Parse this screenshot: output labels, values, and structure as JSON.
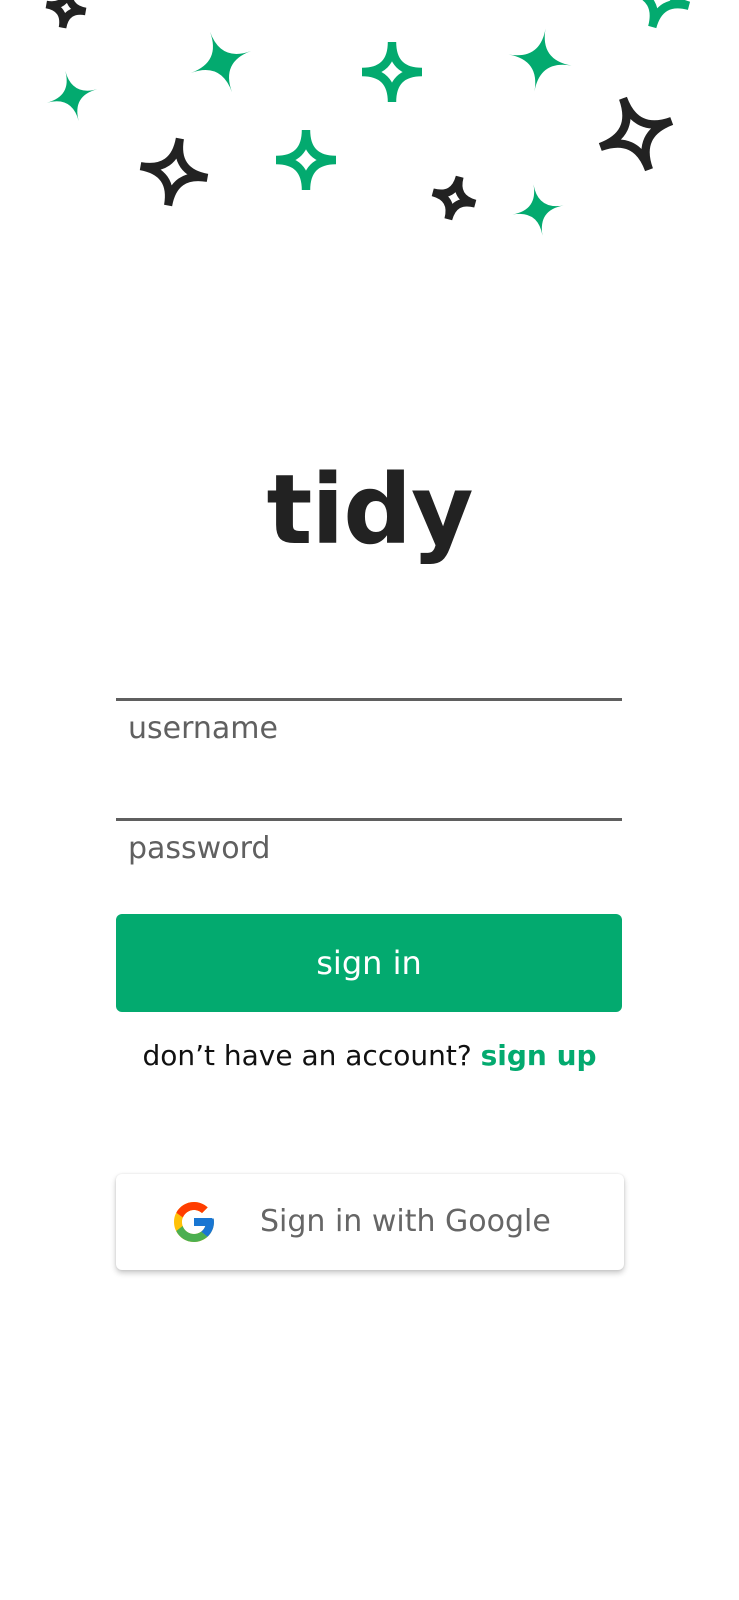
{
  "app": {
    "logo_text": "tidy"
  },
  "form": {
    "username_placeholder": "username",
    "password_placeholder": "password",
    "signin_label": "sign in",
    "no_account_text": "don’t have an account? ",
    "signup_link": "sign up"
  },
  "google": {
    "label": "Sign in with Google",
    "icon": "google-g-icon"
  },
  "theme": {
    "accent": "#03aa6f",
    "dark": "#222222",
    "google_blue": "#4285F4",
    "google_red": "#EA4335",
    "google_yellow": "#FBBC05",
    "google_green": "#34A853"
  },
  "decorations": {
    "icon": "sparkle-icon"
  }
}
